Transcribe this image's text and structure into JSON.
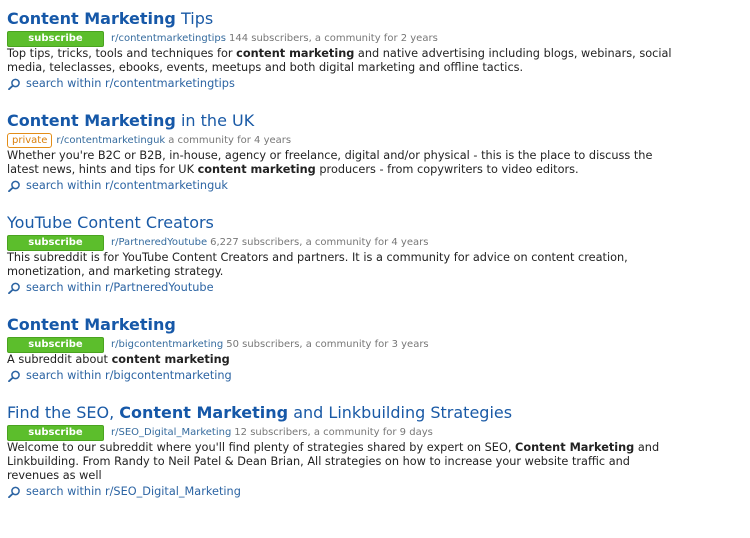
{
  "results": [
    {
      "title": [
        {
          "text": "Content Marketing",
          "bold": true
        },
        {
          "text": " Tips",
          "bold": false
        }
      ],
      "button": "subscribe",
      "button_type": "subscribe",
      "subreddit": "r/contentmarketingtips",
      "meta": "144 subscribers, a community for 2 years",
      "description": [
        {
          "text": "Top tips, tricks, tools and techniques for ",
          "bold": false
        },
        {
          "text": "content marketing",
          "bold": true
        },
        {
          "text": " and native advertising including blogs, webinars, social media, teleclasses, ebooks, events, meetups and both digital marketing and offline tactics.",
          "bold": false
        }
      ],
      "search": "search within r/contentmarketingtips"
    },
    {
      "title": [
        {
          "text": "Content Marketing",
          "bold": true
        },
        {
          "text": " in the UK",
          "bold": false
        }
      ],
      "button": "private",
      "button_type": "private",
      "subreddit": "r/contentmarketinguk",
      "meta": "a community for 4 years",
      "description": [
        {
          "text": "Whether you're B2C or B2B, in-house, agency or freelance, digital and/or physical - this is the place to discuss the latest news, hints and tips for UK ",
          "bold": false
        },
        {
          "text": "content marketing",
          "bold": true
        },
        {
          "text": " producers - from copywriters to video editors.",
          "bold": false
        }
      ],
      "search": "search within r/contentmarketinguk"
    },
    {
      "title": [
        {
          "text": "YouTube Content Creators",
          "bold": false
        }
      ],
      "button": "subscribe",
      "button_type": "subscribe",
      "subreddit": "r/PartneredYoutube",
      "meta": "6,227 subscribers, a community for 4 years",
      "description": [
        {
          "text": "This subreddit is for YouTube Content Creators and partners. It is a community for advice on content creation, monetization, and marketing strategy.",
          "bold": false
        }
      ],
      "search": "search within r/PartneredYoutube"
    },
    {
      "title": [
        {
          "text": "Content Marketing",
          "bold": true
        }
      ],
      "button": "subscribe",
      "button_type": "subscribe",
      "subreddit": "r/bigcontentmarketing",
      "meta": "50 subscribers, a community for 3 years",
      "description": [
        {
          "text": "A subreddit about ",
          "bold": false
        },
        {
          "text": "content marketing",
          "bold": true
        }
      ],
      "search": "search within r/bigcontentmarketing"
    },
    {
      "title": [
        {
          "text": "Find the SEO, ",
          "bold": false
        },
        {
          "text": "Content Marketing",
          "bold": true
        },
        {
          "text": " and Linkbuilding Strategies",
          "bold": false
        }
      ],
      "button": "subscribe",
      "button_type": "subscribe",
      "subreddit": "r/SEO_Digital_Marketing",
      "meta": "12 subscribers, a community for 9 days",
      "description": [
        {
          "text": "Welcome to our subreddit where you'll find plenty of strategies shared by expert on SEO, ",
          "bold": false
        },
        {
          "text": "Content Marketing",
          "bold": true
        },
        {
          "text": " and Linkbuilding. From Randy to Neil Patel & Dean Brian, All strategies on how to increase your website traffic and revenues as well",
          "bold": false
        }
      ],
      "search": "search within r/SEO_Digital_Marketing"
    }
  ]
}
